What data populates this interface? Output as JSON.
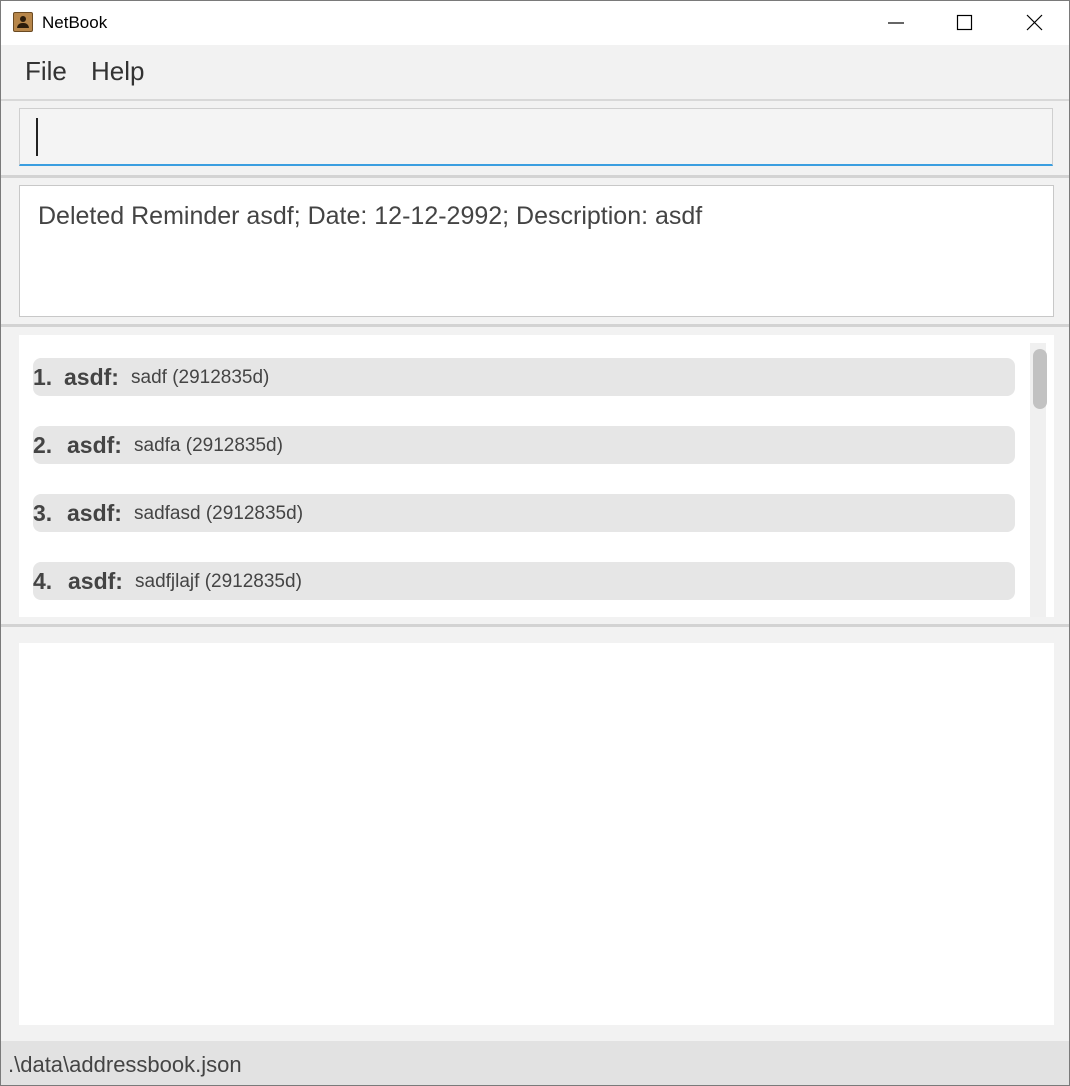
{
  "window": {
    "title": "NetBook",
    "icon": "address-book-icon"
  },
  "menu": {
    "items": [
      {
        "label": "File"
      },
      {
        "label": "Help"
      }
    ]
  },
  "command": {
    "value": ""
  },
  "result": {
    "message": "Deleted Reminder asdf; Date: 12-12-2992; Description: asdf"
  },
  "list": {
    "items": [
      {
        "index": "1.",
        "name": "asdf:",
        "detail": "sadf (2912835d)"
      },
      {
        "index": "2.",
        "name": "asdf:",
        "detail": "sadfa (2912835d)"
      },
      {
        "index": "3.",
        "name": "asdf:",
        "detail": "sadfasd (2912835d)"
      },
      {
        "index": "4.",
        "name": "asdf:",
        "detail": "sadfjlajf (2912835d)"
      }
    ]
  },
  "status": {
    "path": ".\\data\\addressbook.json"
  },
  "colors": {
    "accent": "#3a9ee0",
    "card": "#e6e6e6",
    "panel": "#f2f2f2"
  }
}
